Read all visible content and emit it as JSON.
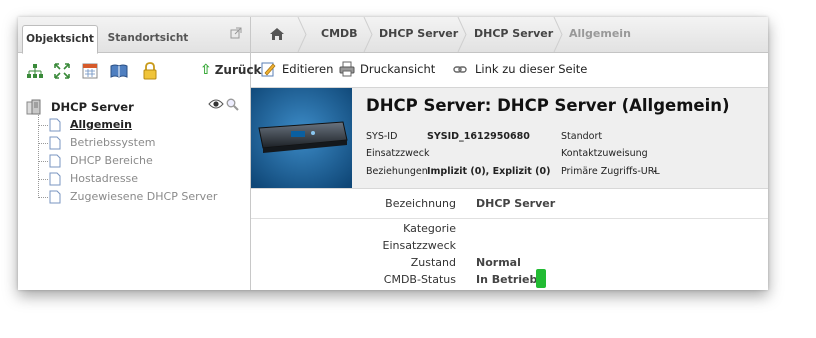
{
  "left_panel": {
    "tabs": [
      {
        "label": "Objektsicht",
        "active": true
      },
      {
        "label": "Standortsicht",
        "active": false
      }
    ],
    "toolbar": {
      "back_label": "Zurück",
      "icons": [
        "hierarchy-icon",
        "expand-arrows-icon",
        "calendar-icon",
        "book-icon",
        "lock-icon"
      ]
    },
    "tree": {
      "root_label": "DHCP Server",
      "children": [
        {
          "label": "Allgemein",
          "active": true
        },
        {
          "label": "Betriebssystem",
          "active": false
        },
        {
          "label": "DHCP Bereiche",
          "active": false
        },
        {
          "label": "Hostadresse",
          "active": false
        },
        {
          "label": "Zugewiesene DHCP Server",
          "active": false
        }
      ]
    }
  },
  "breadcrumb": {
    "items": [
      "CMDB",
      "DHCP Server",
      "DHCP Server",
      "Allgemein"
    ]
  },
  "actions": {
    "edit": "Editieren",
    "print": "Druckansicht",
    "link": "Link zu dieser Seite"
  },
  "header": {
    "title": "DHCP Server: DHCP Server (Allgemein)",
    "sysid_label": "SYS-ID",
    "sysid_value": "SYSID_1612950680",
    "purpose_label": "Einsatzzweck",
    "relations_label": "Beziehungen",
    "relations_value": "Implizit (0), Explizit (0)",
    "location_label": "Standort",
    "contact_label": "Kontaktzuweisung",
    "url_label": "Primäre Zugriffs-URL",
    "url_value": "-"
  },
  "fields": {
    "bezeichnung_label": "Bezeichnung",
    "bezeichnung_value": "DHCP Server",
    "kategorie_label": "Kategorie",
    "einsatzzweck_label": "Einsatzzweck",
    "zustand_label": "Zustand",
    "zustand_value": "Normal",
    "status_label": "CMDB-Status",
    "status_value": "In Betrieb",
    "status_color": "#22bb33"
  },
  "colors": {
    "hero_blue": "#1c5f95",
    "back_arrow": "#3aa93a"
  }
}
